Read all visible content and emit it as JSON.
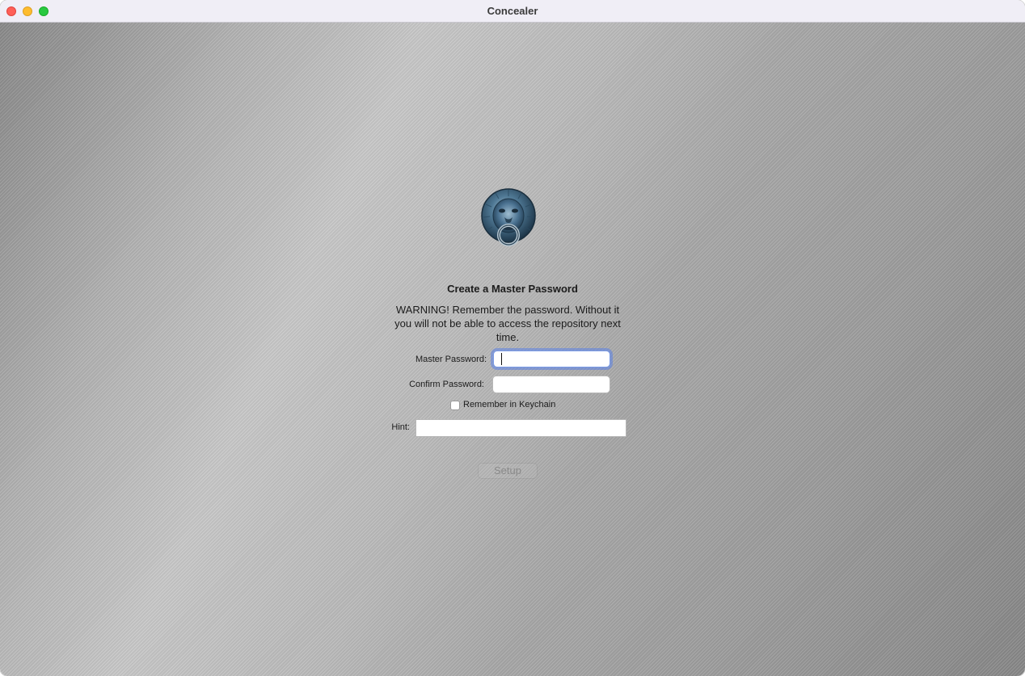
{
  "window": {
    "title": "Concealer"
  },
  "form": {
    "heading": "Create a Master Password",
    "warning": "WARNING! Remember the password. Without it you will not be able to access the repository next time.",
    "master_password_label": "Master Password:",
    "master_password_value": "",
    "confirm_password_label": "Confirm Password:",
    "confirm_password_value": "",
    "remember_keychain_label": "Remember in Keychain",
    "remember_keychain_checked": false,
    "hint_label": "Hint:",
    "hint_value": "",
    "setup_button_label": "Setup",
    "setup_button_enabled": false
  },
  "icons": {
    "logo": "lion-door-knocker-icon",
    "close": "close-window-icon",
    "minimize": "minimize-window-icon",
    "maximize": "maximize-window-icon"
  },
  "colors": {
    "focus_ring": "#5b82e6",
    "close": "#fe5f57",
    "minimize": "#febc2e",
    "maximize": "#28c840"
  }
}
